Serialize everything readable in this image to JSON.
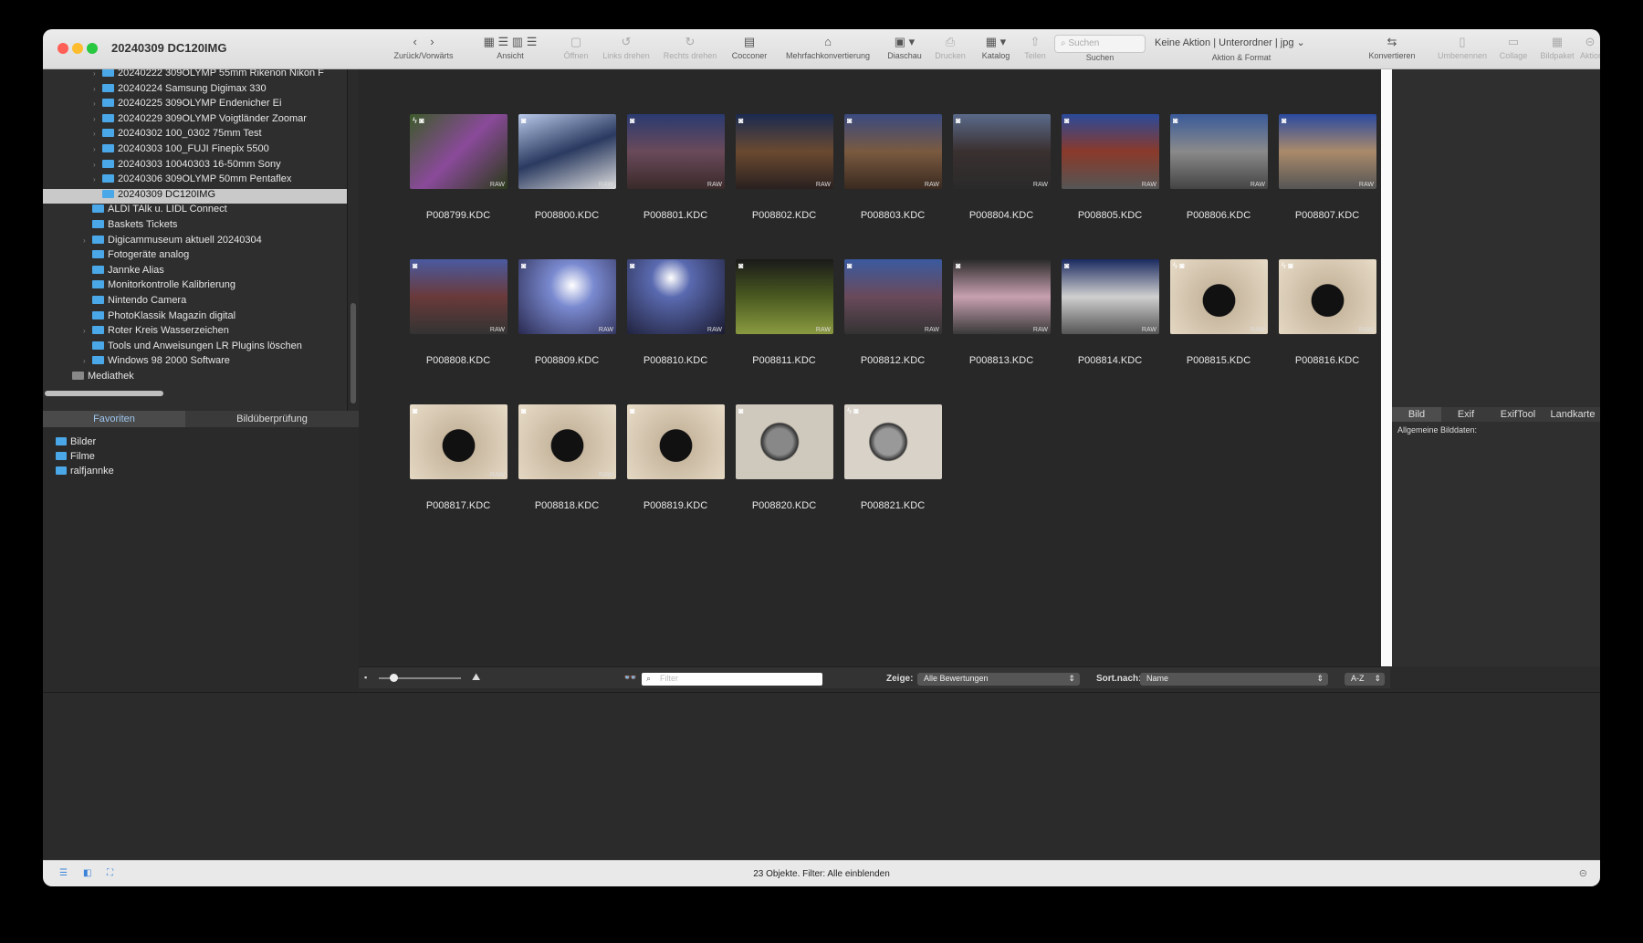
{
  "window": {
    "title": "20240309 DC120IMG"
  },
  "toolbar": {
    "nav_label": "Zurück/Vorwärts",
    "view_label": "Ansicht",
    "open_label": "Öffnen",
    "rotate_left_label": "Links drehen",
    "rotate_right_label": "Rechts drehen",
    "cocooner_label": "Cocconer",
    "batch_label": "Mehrfachkonvertierung",
    "slideshow_label": "Diaschau",
    "print_label": "Drucken",
    "catalog_label": "Katalog",
    "share_label": "Teilen",
    "search_label": "Suchen",
    "search_placeholder": "Suchen",
    "action_value": "Keine Aktion | Unterordner | jpg",
    "action_label": "Aktion & Format",
    "convert_label": "Konvertieren",
    "rename_label": "Umbenennen",
    "collage_label": "Collage",
    "package_label": "Bildpaket",
    "aktion_label": "Aktion"
  },
  "tree": {
    "items": [
      "20240222 309OLYMP 55mm Rikenon Nikon F",
      "20240224 Samsung Digimax 330",
      "20240225 309OLYMP Endenicher Ei",
      "20240229 309OLYMP Voigtländer Zoomar",
      "20240302 100_0302 75mm Test",
      "20240303 100_FUJI Finepix 5500",
      "20240303 10040303 16-50mm Sony",
      "20240306 309OLYMP 50mm Pentaflex",
      "20240309 DC120IMG",
      "ALDI TAlk u. LIDL Connect",
      "Baskets Tickets",
      "Digicammuseum aktuell 20240304",
      "Fotogeräte analog",
      "Jannke Alias",
      "Monitorkontrolle Kalibrierung",
      "Nintendo Camera",
      "PhotoKlassik Magazin digital",
      "Roter Kreis Wasserzeichen",
      "Tools und Anweisungen LR Plugins löschen",
      "Windows 98 2000 Software",
      "Mediathek"
    ]
  },
  "sidetabs": {
    "favorites": "Favoriten",
    "review": "Bildüberprüfung"
  },
  "favorites": [
    "Bilder",
    "Filme",
    "ralfjannke"
  ],
  "thumbs": {
    "raw_label": "RAW",
    "files": [
      "P008799.KDC",
      "P008800.KDC",
      "P008801.KDC",
      "P008802.KDC",
      "P008803.KDC",
      "P008804.KDC",
      "P008805.KDC",
      "P008806.KDC",
      "P008807.KDC",
      "P008808.KDC",
      "P008809.KDC",
      "P008810.KDC",
      "P008811.KDC",
      "P008812.KDC",
      "P008813.KDC",
      "P008814.KDC",
      "P008815.KDC",
      "P008816.KDC",
      "P008817.KDC",
      "P008818.KDC",
      "P008819.KDC",
      "P008820.KDC",
      "P008821.KDC"
    ]
  },
  "gridbar": {
    "filter_placeholder": "Filter",
    "show_label": "Zeige:",
    "show_value": "Alle Bewertungen",
    "sort_label": "Sort.nach:",
    "sort_value": "Name",
    "order_value": "A-Z"
  },
  "infotabs": {
    "bild": "Bild",
    "exif": "Exif",
    "exiftool": "ExifTool",
    "map": "Landkarte"
  },
  "info": {
    "general": "Allgemeine Bilddaten:"
  },
  "status": {
    "text": "23 Objekte. Filter: Alle einblenden"
  }
}
